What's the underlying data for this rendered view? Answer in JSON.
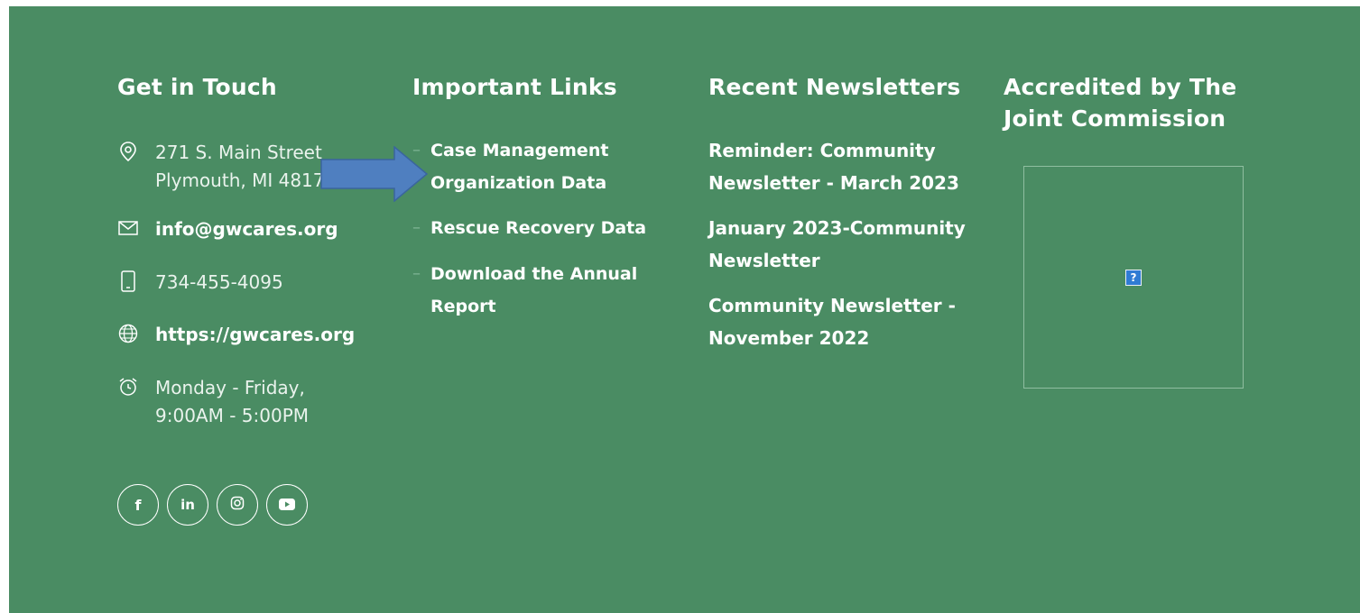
{
  "contact": {
    "heading": "Get in Touch",
    "address": "271 S. Main Street\nPlymouth, MI 48170",
    "email": "info@gwcares.org",
    "phone": "734-455-4095",
    "website": "https://gwcares.org",
    "hours": "Monday - Friday,\n9:00AM - 5:00PM"
  },
  "links": {
    "heading": "Important Links",
    "items": [
      {
        "label": "Case Management Organization Data"
      },
      {
        "label": "Rescue Recovery Data"
      },
      {
        "label": "Download the Annual Report"
      }
    ]
  },
  "newsletters": {
    "heading": "Recent Newsletters",
    "items": [
      {
        "label": "Reminder: Community Newsletter - March 2023"
      },
      {
        "label": "January 2023-Community Newsletter"
      },
      {
        "label": "Community Newsletter - November 2022"
      }
    ]
  },
  "accreditation": {
    "heading": "Accredited by The Joint Commission",
    "broken_image_glyph": "?"
  },
  "social": {
    "facebook": "f",
    "linkedin": "in"
  },
  "colors": {
    "footer_bg": "#4a8c63",
    "arrow": "#4f7fc0"
  }
}
